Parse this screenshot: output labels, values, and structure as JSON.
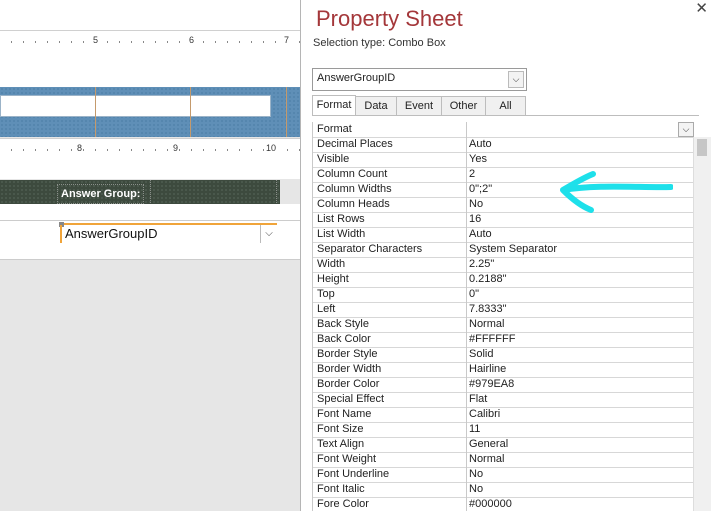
{
  "design": {
    "ruler_top": {
      "marks": [
        "5",
        "6",
        "7"
      ]
    },
    "ruler_mid": {
      "marks": [
        "8",
        "9",
        "10"
      ]
    },
    "label_text": "Answer Group:",
    "combo_text": "AnswerGroupID"
  },
  "sheet": {
    "title": "Property Sheet",
    "selection_type": "Selection type:  Combo Box",
    "object_name": "AnswerGroupID",
    "close_glyph": "✕",
    "tabs": [
      "Format",
      "Data",
      "Event",
      "Other",
      "All"
    ],
    "active_tab": "Format",
    "properties": [
      {
        "name": "Format",
        "value": ""
      },
      {
        "name": "Decimal Places",
        "value": "Auto"
      },
      {
        "name": "Visible",
        "value": "Yes"
      },
      {
        "name": "Column Count",
        "value": "2"
      },
      {
        "name": "Column Widths",
        "value": "0\";2\""
      },
      {
        "name": "Column Heads",
        "value": "No"
      },
      {
        "name": "List Rows",
        "value": "16"
      },
      {
        "name": "List Width",
        "value": "Auto"
      },
      {
        "name": "Separator Characters",
        "value": "System Separator"
      },
      {
        "name": "Width",
        "value": "2.25\""
      },
      {
        "name": "Height",
        "value": "0.2188\""
      },
      {
        "name": "Top",
        "value": "0\""
      },
      {
        "name": "Left",
        "value": "7.8333\""
      },
      {
        "name": "Back Style",
        "value": "Normal"
      },
      {
        "name": "Back Color",
        "value": "#FFFFFF"
      },
      {
        "name": "Border Style",
        "value": "Solid"
      },
      {
        "name": "Border Width",
        "value": "Hairline"
      },
      {
        "name": "Border Color",
        "value": "#979EA8"
      },
      {
        "name": "Special Effect",
        "value": "Flat"
      },
      {
        "name": "Font Name",
        "value": "Calibri"
      },
      {
        "name": "Font Size",
        "value": "11"
      },
      {
        "name": "Text Align",
        "value": "General"
      },
      {
        "name": "Font Weight",
        "value": "Normal"
      },
      {
        "name": "Font Underline",
        "value": "No"
      },
      {
        "name": "Font Italic",
        "value": "No"
      },
      {
        "name": "Fore Color",
        "value": "#000000"
      }
    ]
  },
  "colors": {
    "title": "#a4373a",
    "section_blue": "#5f8fb7",
    "section_dark": "#3d4a3e",
    "selection_orange": "#f0a43a",
    "annotation_cyan": "#1ee0ea"
  },
  "icons": {
    "dropdown": "chevron-down-icon",
    "close": "close-icon"
  }
}
